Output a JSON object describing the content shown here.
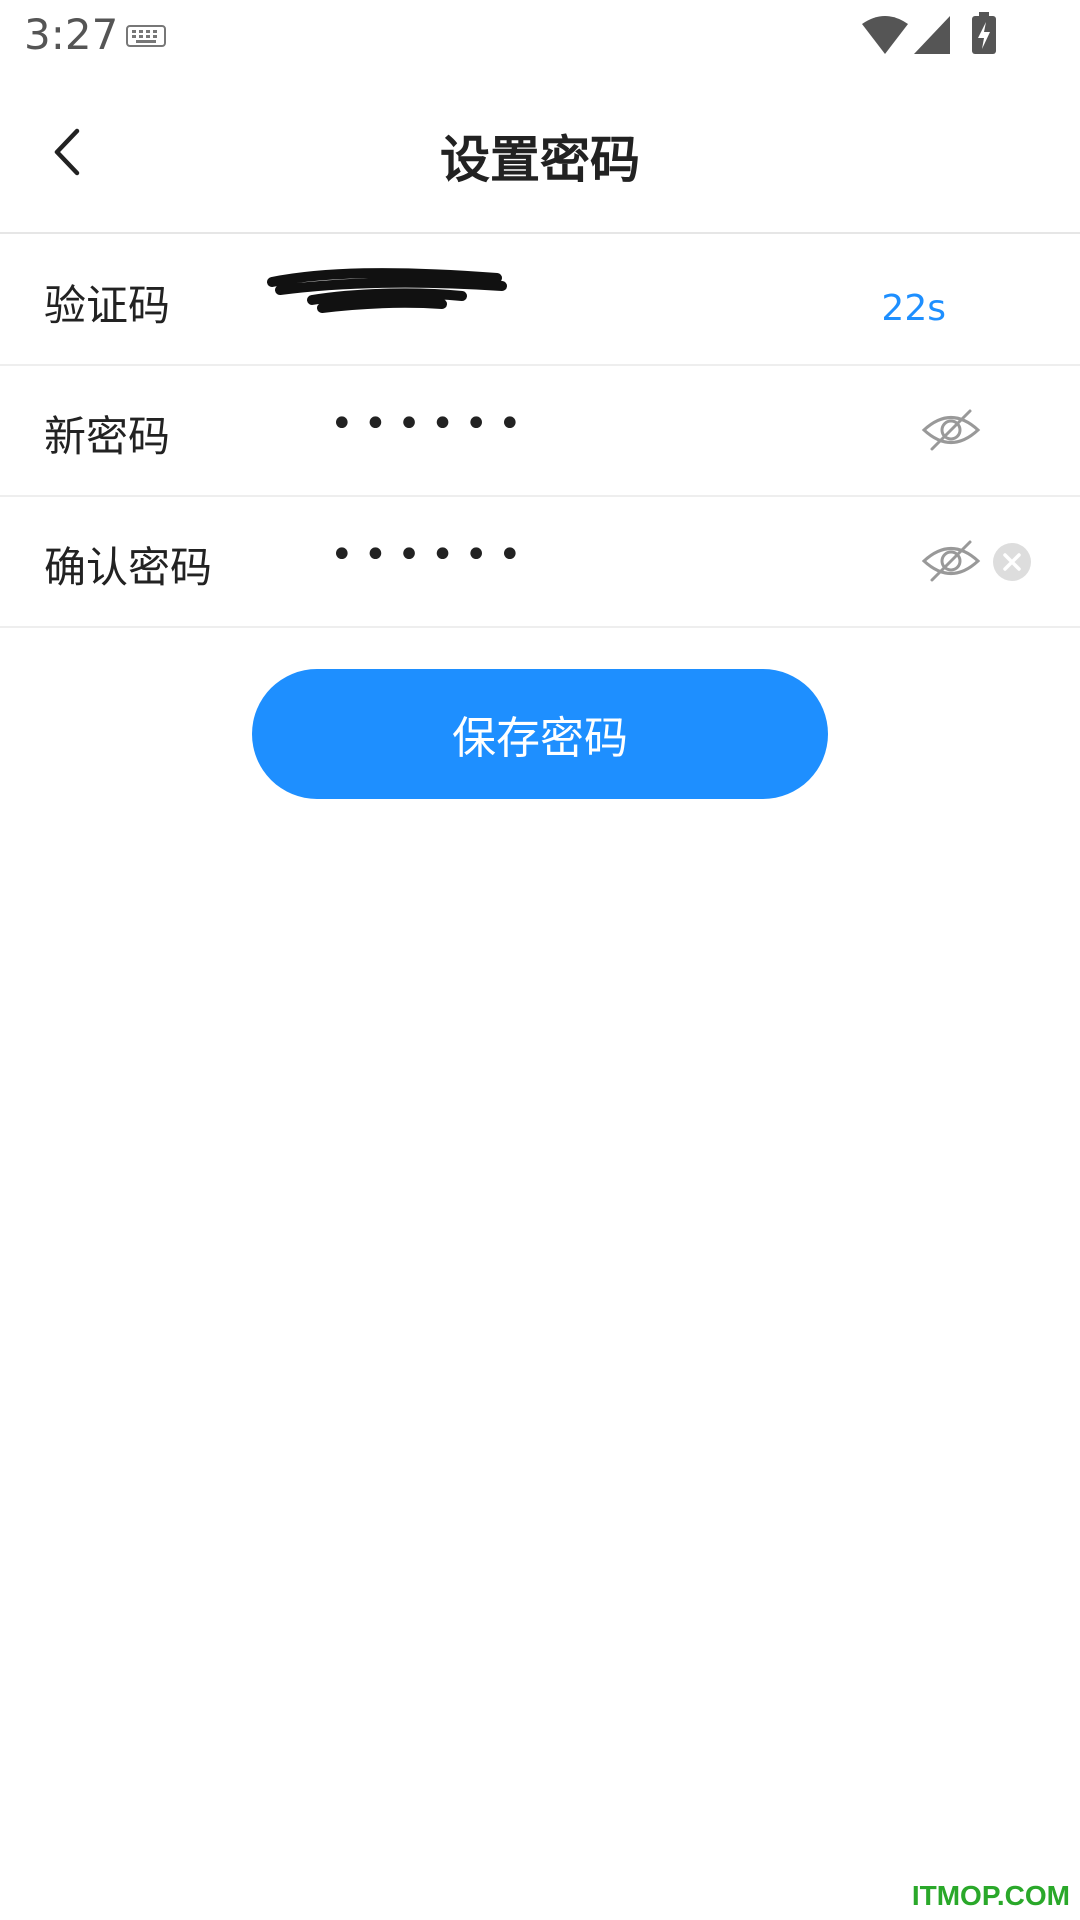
{
  "status_bar": {
    "time": "3:27"
  },
  "header": {
    "title": "设置密码",
    "back_icon": "chevron-left-icon"
  },
  "form": {
    "verification_code": {
      "label": "验证码",
      "value": "",
      "countdown": "22s"
    },
    "new_password": {
      "label": "新密码",
      "value": "••••••",
      "visibility_icon": "eye-off-icon"
    },
    "confirm_password": {
      "label": "确认密码",
      "value": "••••••",
      "visibility_icon": "eye-off-icon",
      "clear_icon": "clear-icon"
    }
  },
  "actions": {
    "save_label": "保存密码"
  },
  "watermark": "ITMOP.COM",
  "colors": {
    "accent": "#1e8fff",
    "divider": "#eeeeee"
  }
}
